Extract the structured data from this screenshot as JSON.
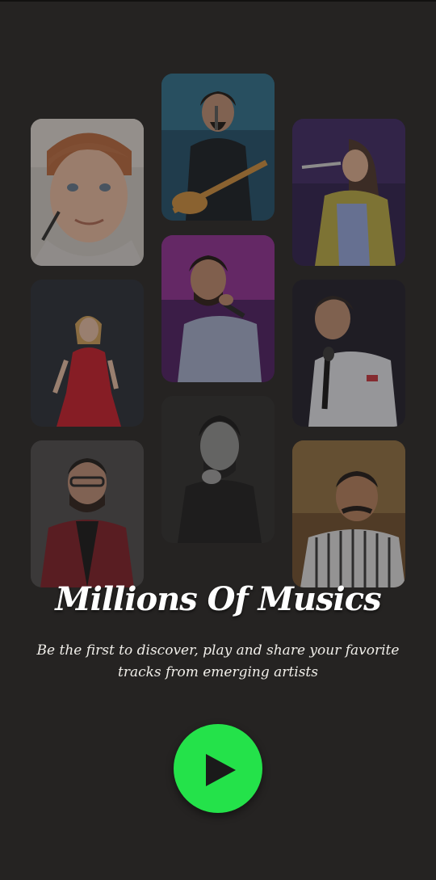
{
  "header": {
    "title": "Millions Of Musics",
    "subtitle": "Be the first to discover, play and share your favorite tracks from emerging artists"
  },
  "artists_grid": {
    "cards": [
      {
        "name": "artist-card-1",
        "icon": "artist-photo"
      },
      {
        "name": "artist-card-2",
        "icon": "artist-photo"
      },
      {
        "name": "artist-card-3",
        "icon": "artist-photo"
      },
      {
        "name": "artist-card-4",
        "icon": "artist-photo"
      },
      {
        "name": "artist-card-5",
        "icon": "artist-photo"
      },
      {
        "name": "artist-card-6",
        "icon": "artist-photo"
      },
      {
        "name": "artist-card-7",
        "icon": "artist-photo"
      },
      {
        "name": "artist-card-8",
        "icon": "artist-photo"
      },
      {
        "name": "artist-card-9",
        "icon": "artist-photo"
      }
    ]
  },
  "play_button": {
    "icon": "play-icon",
    "color": "#24e24a"
  },
  "colors": {
    "background": "#252322",
    "accent": "#24e24a",
    "text": "#ffffff"
  }
}
